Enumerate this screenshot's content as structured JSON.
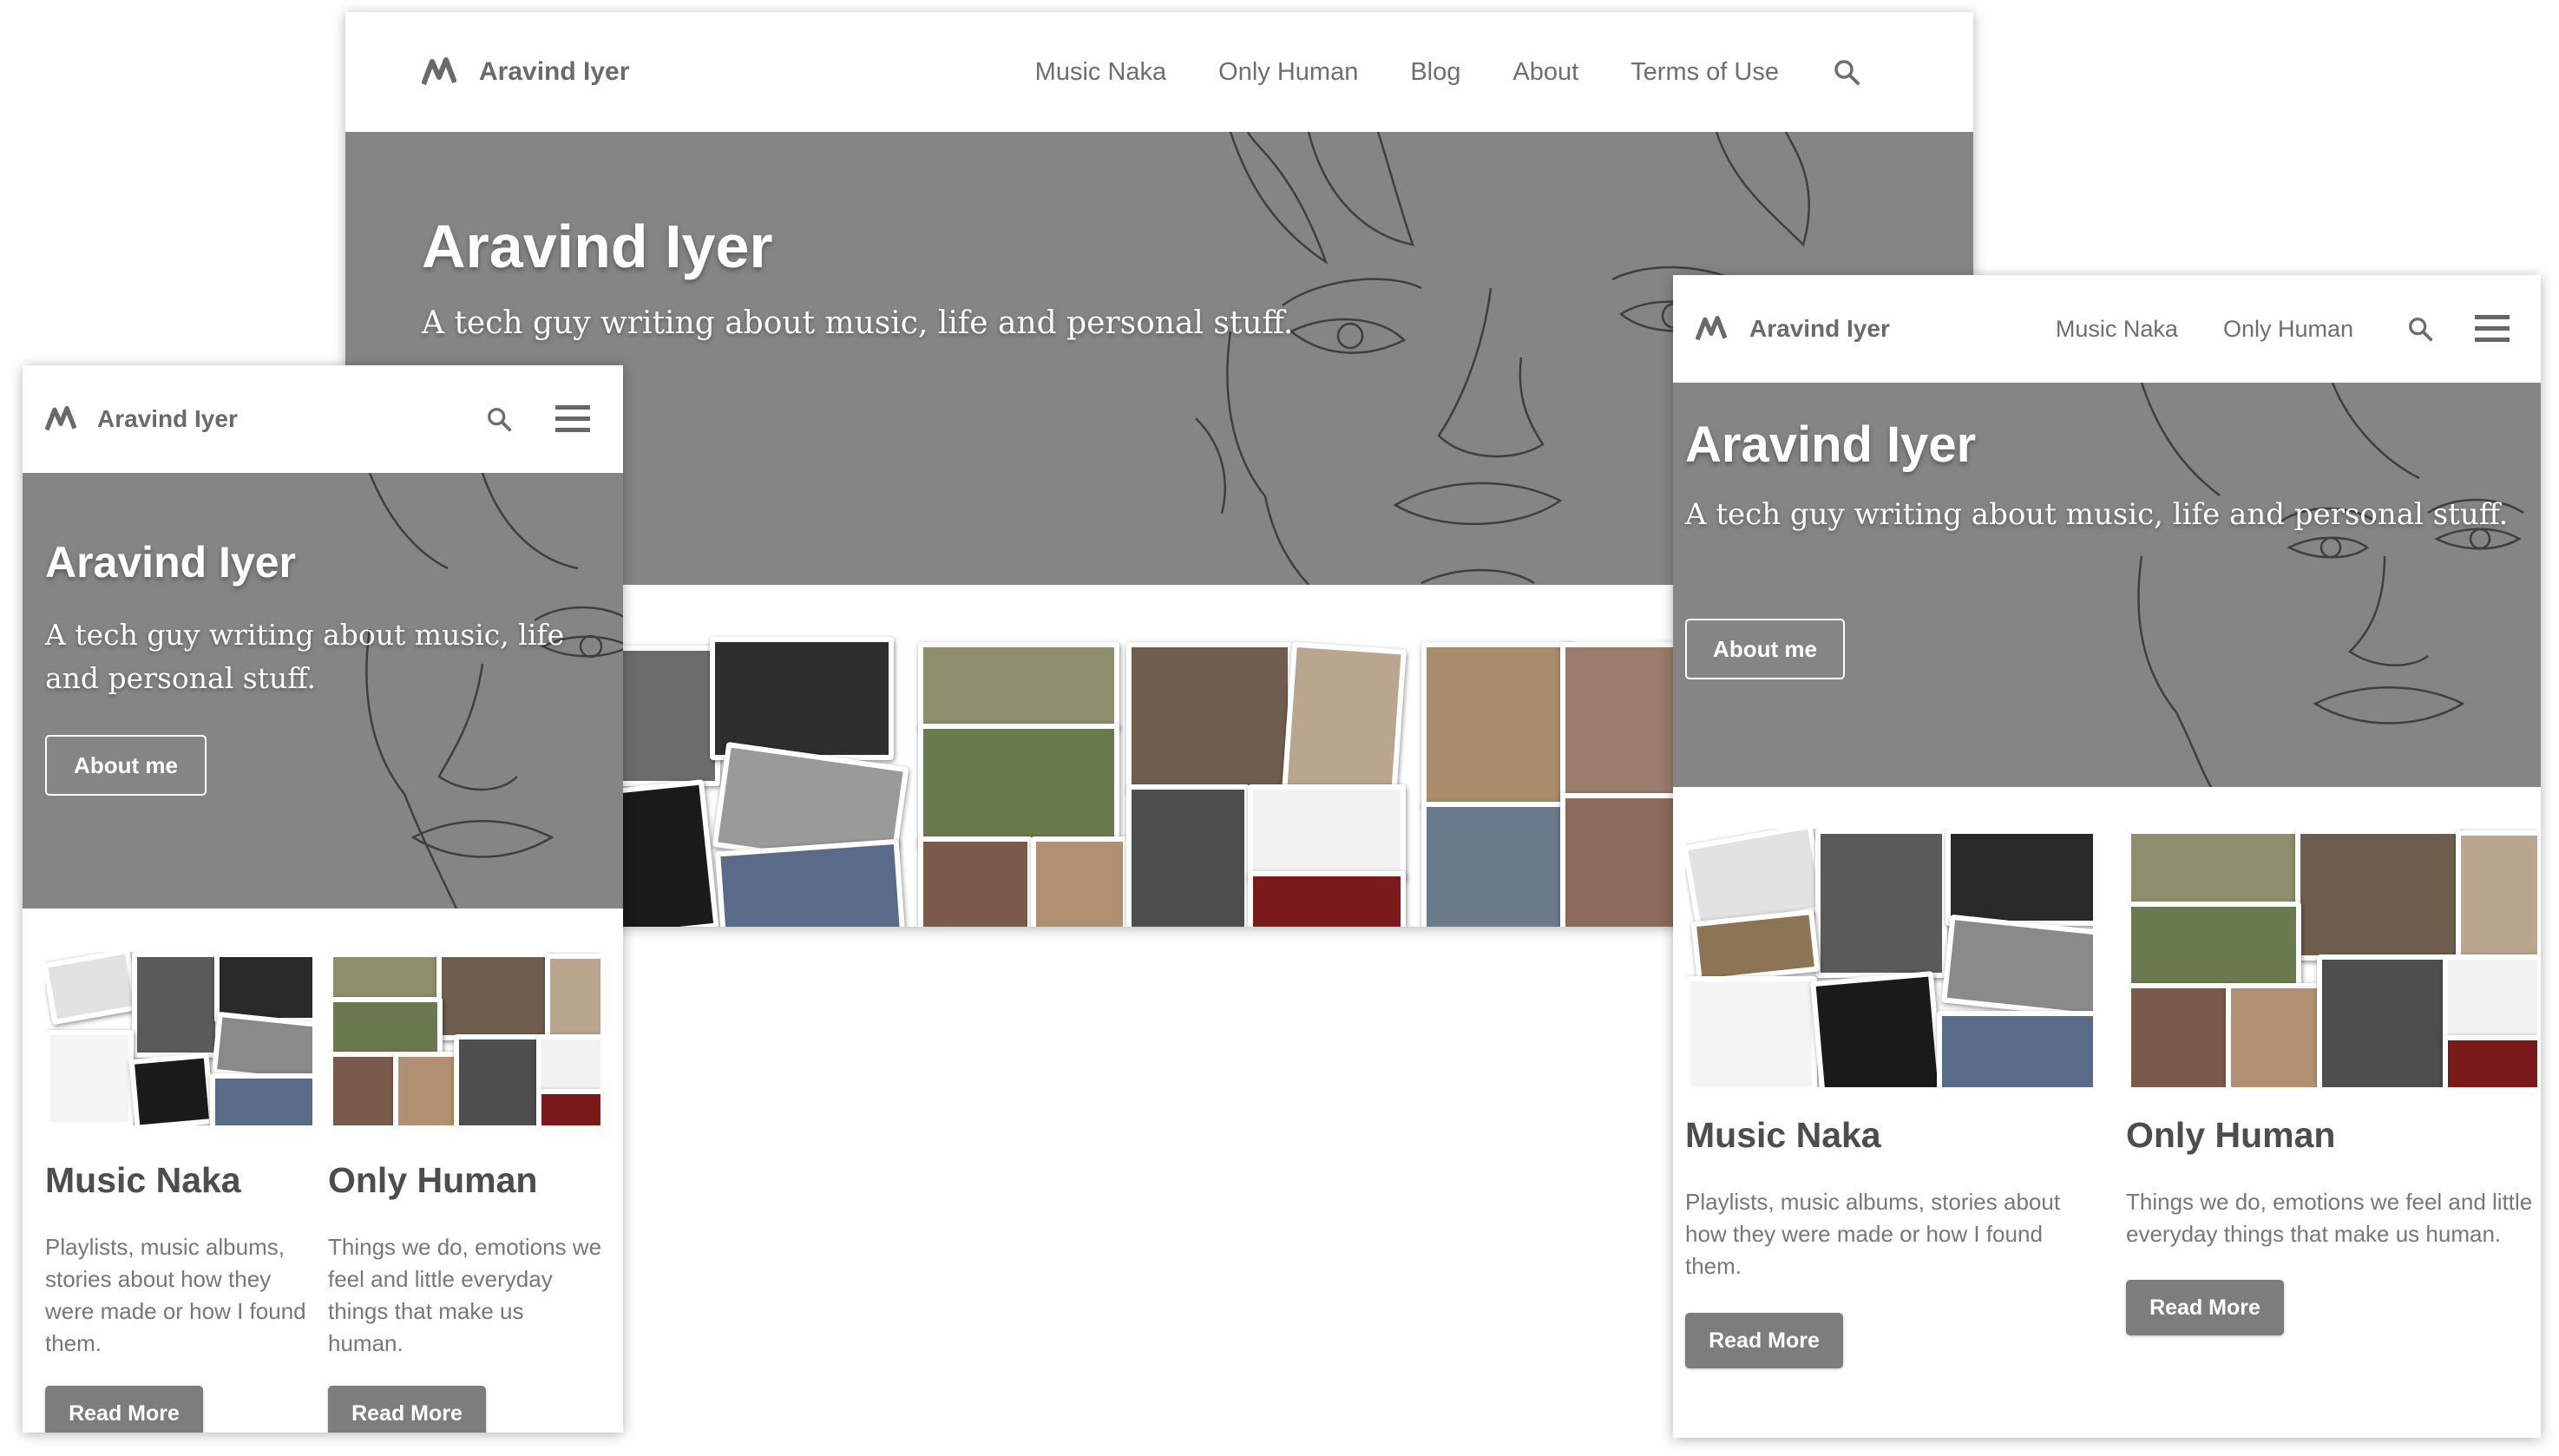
{
  "site": {
    "name": "Aravind Iyer"
  },
  "desktop": {
    "nav": [
      "Music Naka",
      "Only Human",
      "Blog",
      "About",
      "Terms of Use"
    ],
    "hero_title": "Aravind Iyer",
    "hero_subtitle": "A tech guy writing about music, life and personal stuff."
  },
  "tablet": {
    "nav": [
      "Music Naka",
      "Only Human"
    ],
    "hero_title": "Aravind Iyer",
    "hero_subtitle": "A tech guy writing about music, life and personal stuff.",
    "about_button": "About me"
  },
  "mobile": {
    "hero_title": "Aravind Iyer",
    "hero_subtitle": "A tech guy writing about music, life and personal stuff.",
    "about_button": "About me"
  },
  "cards": [
    {
      "title": "Music Naka",
      "description": "Playlists, music albums, stories about how they were made or how I found them.",
      "button": "Read More"
    },
    {
      "title": "Only Human",
      "description": "Things we do, emotions we feel and little everyday things that make us human.",
      "button": "Read More"
    }
  ],
  "icons": [
    "logo-icon",
    "search-icon",
    "hamburger-menu-icon"
  ],
  "colors": {
    "hero_bg": "#858585",
    "button_bg": "#7d7d7d",
    "nav_text": "#6e6e6e"
  }
}
